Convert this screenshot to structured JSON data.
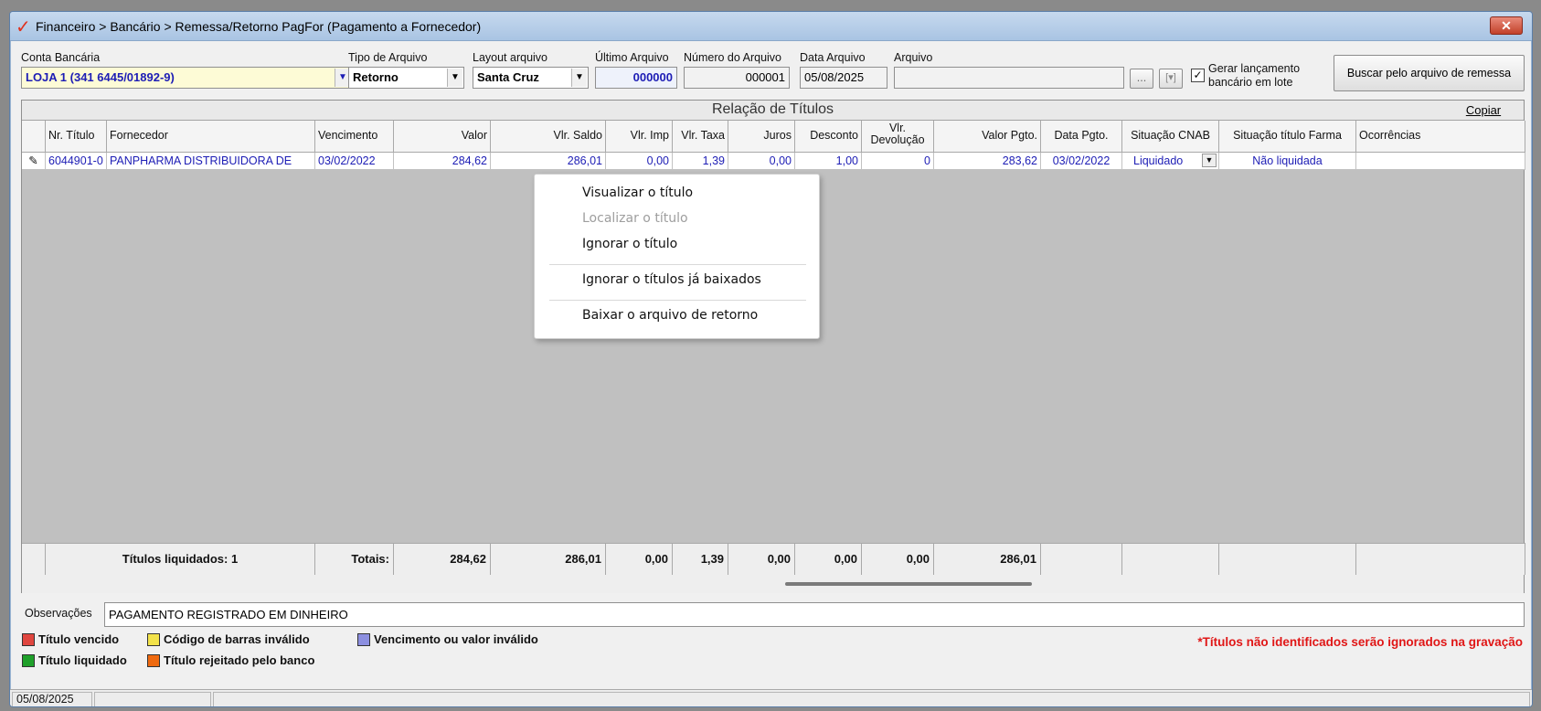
{
  "window": {
    "title": "Financeiro > Bancário > Remessa/Retorno PagFor (Pagamento  a Fornecedor)",
    "close_label": "✕",
    "logo": "✓"
  },
  "filters": {
    "conta_bancaria": {
      "label": "Conta Bancária",
      "value": "LOJA 1 (341 6445/01892-9)"
    },
    "tipo_arquivo": {
      "label": "Tipo de Arquivo",
      "value": "Retorno"
    },
    "layout_arquivo": {
      "label": "Layout arquivo",
      "value": "Santa Cruz"
    },
    "ultimo_arquivo": {
      "label": "Último Arquivo",
      "value": "000000"
    },
    "numero_arquivo": {
      "label": "Número do Arquivo",
      "value": "000001"
    },
    "data_arquivo": {
      "label": "Data Arquivo",
      "value": "05/08/2025"
    },
    "arquivo": {
      "label": "Arquivo",
      "value": ""
    },
    "browse_label": "...",
    "view_label": "[▾]",
    "gerar_lancamento": {
      "label_line1": "Gerar lançamento",
      "label_line2": "bancário em lote",
      "checked": true
    },
    "buscar_button": "Buscar pelo arquivo de remessa"
  },
  "grid": {
    "caption": "Relação de Títulos",
    "copy_label": "Copiar",
    "columns": {
      "nr_titulo": "Nr. Título",
      "fornecedor": "Fornecedor",
      "vencimento": "Vencimento",
      "valor": "Valor",
      "vlr_saldo": "Vlr. Saldo",
      "vlr_imp": "Vlr. Imp",
      "vlr_taxa": "Vlr. Taxa",
      "juros": "Juros",
      "desconto": "Desconto",
      "vlr_devolucao_1": "Vlr.",
      "vlr_devolucao_2": "Devolução",
      "valor_pgto": "Valor Pgto.",
      "data_pgto": "Data Pgto.",
      "situacao_cnab": "Situação CNAB",
      "situacao_farma": "Situação título Farma",
      "ocorrencias": "Ocorrências"
    },
    "row": {
      "indicator": "✎",
      "nr_titulo": "6044901-0",
      "fornecedor": "PANPHARMA DISTRIBUIDORA DE",
      "vencimento": "03/02/2022",
      "valor": "284,62",
      "vlr_saldo": "286,01",
      "vlr_imp": "0,00",
      "vlr_taxa": "1,39",
      "juros": "0,00",
      "desconto": "1,00",
      "vlr_devolucao": "0",
      "valor_pgto": "283,62",
      "data_pgto": "03/02/2022",
      "situacao_cnab": "Liquidado",
      "situacao_farma": "Não liquidada",
      "ocorrencias": ""
    },
    "footer": {
      "titulos_liquidados": "Títulos liquidados: 1",
      "totais_label": "Totais:",
      "valor": "284,62",
      "vlr_saldo": "286,01",
      "vlr_imp": "0,00",
      "vlr_taxa": "1,39",
      "juros": "0,00",
      "desconto": "0,00",
      "vlr_devolucao": "0,00",
      "valor_pgto": "286,01"
    }
  },
  "context_menu": {
    "items": [
      {
        "label": "Visualizar o título",
        "enabled": true
      },
      {
        "label": "Localizar o título",
        "enabled": false
      },
      {
        "label": "Ignorar o título",
        "enabled": true
      },
      {
        "label": "Ignorar o títulos já baixados",
        "enabled": true
      },
      {
        "label": "Baixar o arquivo de retorno",
        "enabled": true
      }
    ]
  },
  "observacoes": {
    "label": "Observações",
    "value": "PAGAMENTO REGISTRADO EM DINHEIRO"
  },
  "legend": {
    "items": [
      {
        "label": "Título vencido",
        "color": "#e0463f"
      },
      {
        "label": "Código de barras inválido",
        "color": "#f2e24a"
      },
      {
        "label": "Vencimento ou valor inválido",
        "color": "#8c8fe0"
      },
      {
        "label": "Título liquidado",
        "color": "#1fa02a"
      },
      {
        "label": "Título rejeitado pelo banco",
        "color": "#ef6a10"
      }
    ],
    "warning": "*Títulos não identificados serão ignorados na gravação",
    "warning_color": "#e01616"
  },
  "statusbar": {
    "date": "05/08/2025"
  }
}
